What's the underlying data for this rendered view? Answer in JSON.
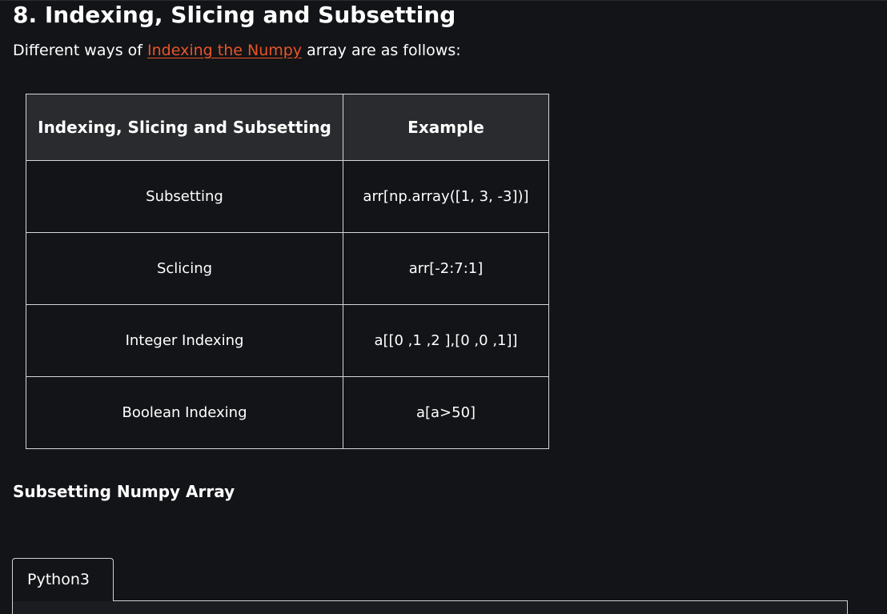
{
  "section": {
    "title": "8. Indexing, Slicing and Subsetting",
    "intro_before": "Different ways of ",
    "intro_link": "Indexing the Numpy",
    "intro_after": " array are as follows:"
  },
  "table": {
    "headers": [
      "Indexing, Slicing and Subsetting",
      "Example"
    ],
    "rows": [
      {
        "method": "Subsetting",
        "example": "arr[np.array([1, 3, -3])]"
      },
      {
        "method": "Sclicing",
        "example": "arr[-2:7:1]"
      },
      {
        "method": "Integer Indexing",
        "example": "a[[0 ,1 ,2 ],[0 ,0 ,1]]"
      },
      {
        "method": "Boolean Indexing",
        "example": "a[a>50]"
      }
    ]
  },
  "subsection": {
    "title": "Subsetting Numpy Array"
  },
  "code": {
    "tab_label": "Python3"
  },
  "colors": {
    "background": "#131417",
    "link": "#e8552a",
    "header_bg": "#2a2b2e",
    "border": "#d6d6d6"
  }
}
